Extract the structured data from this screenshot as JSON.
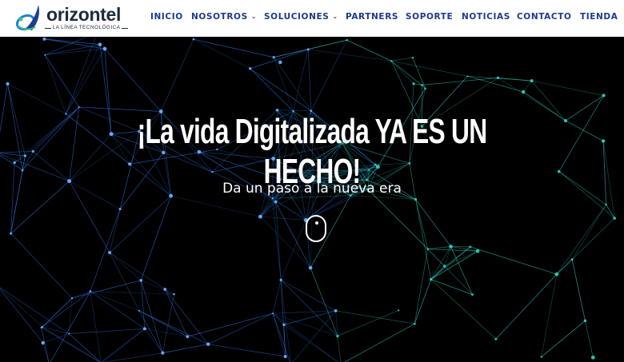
{
  "header": {
    "logo": {
      "name": "orizontel",
      "tagline": "LA LÍNEA TECNOLÓGICA"
    },
    "nav": [
      {
        "label": "INICIO",
        "has_dropdown": false
      },
      {
        "label": "NOSOTROS",
        "has_dropdown": true
      },
      {
        "label": "SOLUCIONES",
        "has_dropdown": true
      },
      {
        "label": "PARTNERS",
        "has_dropdown": false
      },
      {
        "label": "SOPORTE",
        "has_dropdown": false
      },
      {
        "label": "NOTICIAS",
        "has_dropdown": false
      },
      {
        "label": "CONTACTO",
        "has_dropdown": false
      },
      {
        "label": "TIENDA",
        "has_dropdown": false
      }
    ],
    "dropdown_icon": "chevron-down-icon"
  },
  "hero": {
    "headline": "¡La vida Digitalizada YA ES UN HECHO!",
    "subheadline": "Da un paso a la nueva era",
    "scroll_icon": "mouse-scroll-icon",
    "background": "network-lines-background"
  },
  "colors": {
    "header_bg": "#ffffff",
    "nav_text": "#1d3a8a",
    "hero_bg": "#000000",
    "network_teal": "#2fd3c5",
    "network_blue": "#2a6fd6",
    "logo_text": "#1d2b3a"
  }
}
